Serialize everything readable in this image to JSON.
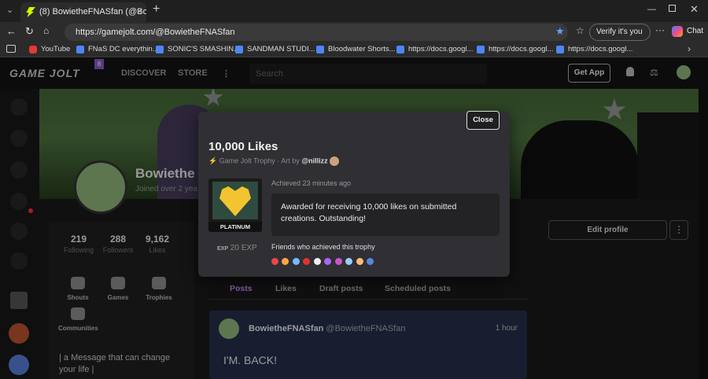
{
  "browser": {
    "tab_title": "(8) BowietheFNASfan (@Bowiethe",
    "tab_close": "×",
    "new_tab": "+",
    "url": "https://gamejolt.com/@BowietheFNASfan",
    "verify": "Verify it's you",
    "chat": "Chat",
    "bookmarks": [
      "YouTube",
      "FNaS DC everythin...",
      "SONIC'S SMASHIN...",
      "SANDMAN STUDI...",
      "Bloodwater Shorts...",
      "https://docs.googl...",
      "https://docs.googl...",
      "https://docs.googl..."
    ]
  },
  "site": {
    "logo": "GAME JOLT",
    "logo_badge": "8",
    "nav": {
      "discover": "DISCOVER",
      "store": "STORE"
    },
    "search_placeholder": "Search",
    "get_app": "Get App"
  },
  "profile": {
    "name": "Bowiethe",
    "joined": "Joined over 2 yea",
    "stats": [
      {
        "value": "219",
        "label": "Following"
      },
      {
        "value": "288",
        "label": "Followers"
      },
      {
        "value": "9,162",
        "label": "Likes"
      }
    ],
    "categories": [
      "Shouts",
      "Games",
      "Trophies",
      "Communities"
    ],
    "bio": "| a Message that can change your life |",
    "edit_profile": "Edit profile",
    "tabs": [
      "Posts",
      "Likes",
      "Draft posts",
      "Scheduled posts"
    ],
    "post": {
      "user": "BowietheFNASfan",
      "handle": "@BowietheFNASfan",
      "time": "1 hour",
      "body": "I'M. BACK!"
    }
  },
  "modal": {
    "close": "Close",
    "title": "10,000 Likes",
    "subtitle_type": "Game Jolt Trophy",
    "subtitle_dot": "·",
    "art_by": "Art by",
    "artist": "@nillizz",
    "tier": "PLATINUM",
    "exp": "20 EXP",
    "achieved": "Achieved 23 minutes ago",
    "description": "Awarded for receiving 10,000 likes on submitted creations. Outstanding!",
    "friends_label": "Friends who achieved this trophy"
  },
  "colors": {
    "accent_green": "#ccff00",
    "badge_purple": "#8a58c7",
    "post_card": "#262d4a",
    "trophy_gold": "#f2c430"
  }
}
